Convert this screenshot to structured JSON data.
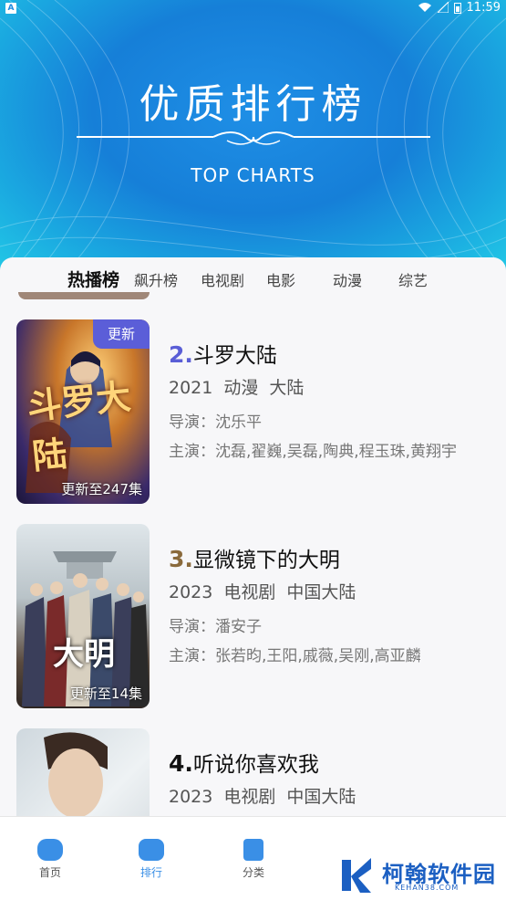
{
  "status_bar": {
    "badge": "A",
    "time": "11:59"
  },
  "hero": {
    "title": "优质排行榜",
    "subtitle": "TOP CHARTS"
  },
  "tabs": [
    "热播榜",
    "飙升榜",
    "电视剧",
    "电影",
    "动漫",
    "综艺"
  ],
  "items": [
    {
      "rank": "2.",
      "title": "斗罗大陆",
      "meta": "2021 动漫 大陆",
      "director": "导演：沈乐平",
      "cast": "主演：沈磊,翟巍,吴磊,陶典,程玉珠,黄翔宇",
      "badge": "更新",
      "episodes": "更新至247集",
      "poster_title": "斗罗大陆",
      "rank_color": "#5a5ed6"
    },
    {
      "rank": "3.",
      "title": "显微镜下的大明",
      "meta": "2023 电视剧 中国大陆",
      "director": "导演：潘安子",
      "cast": "主演：张若昀,王阳,戚薇,吴刚,高亚麟",
      "episodes": "更新至14集",
      "poster_title": "大明",
      "rank_color": "#8a6a3c"
    },
    {
      "rank": "4.",
      "title": "听说你喜欢我",
      "meta": "2023 电视剧 中国大陆",
      "rank_color": "#111111"
    }
  ],
  "nav": [
    {
      "label": "首页",
      "icon": "home-icon"
    },
    {
      "label": "排行",
      "icon": "rank-icon",
      "active": true
    },
    {
      "label": "分类",
      "icon": "category-icon"
    }
  ],
  "watermark": {
    "name": "柯翰软件园",
    "url": "KEHAN38.COM"
  }
}
